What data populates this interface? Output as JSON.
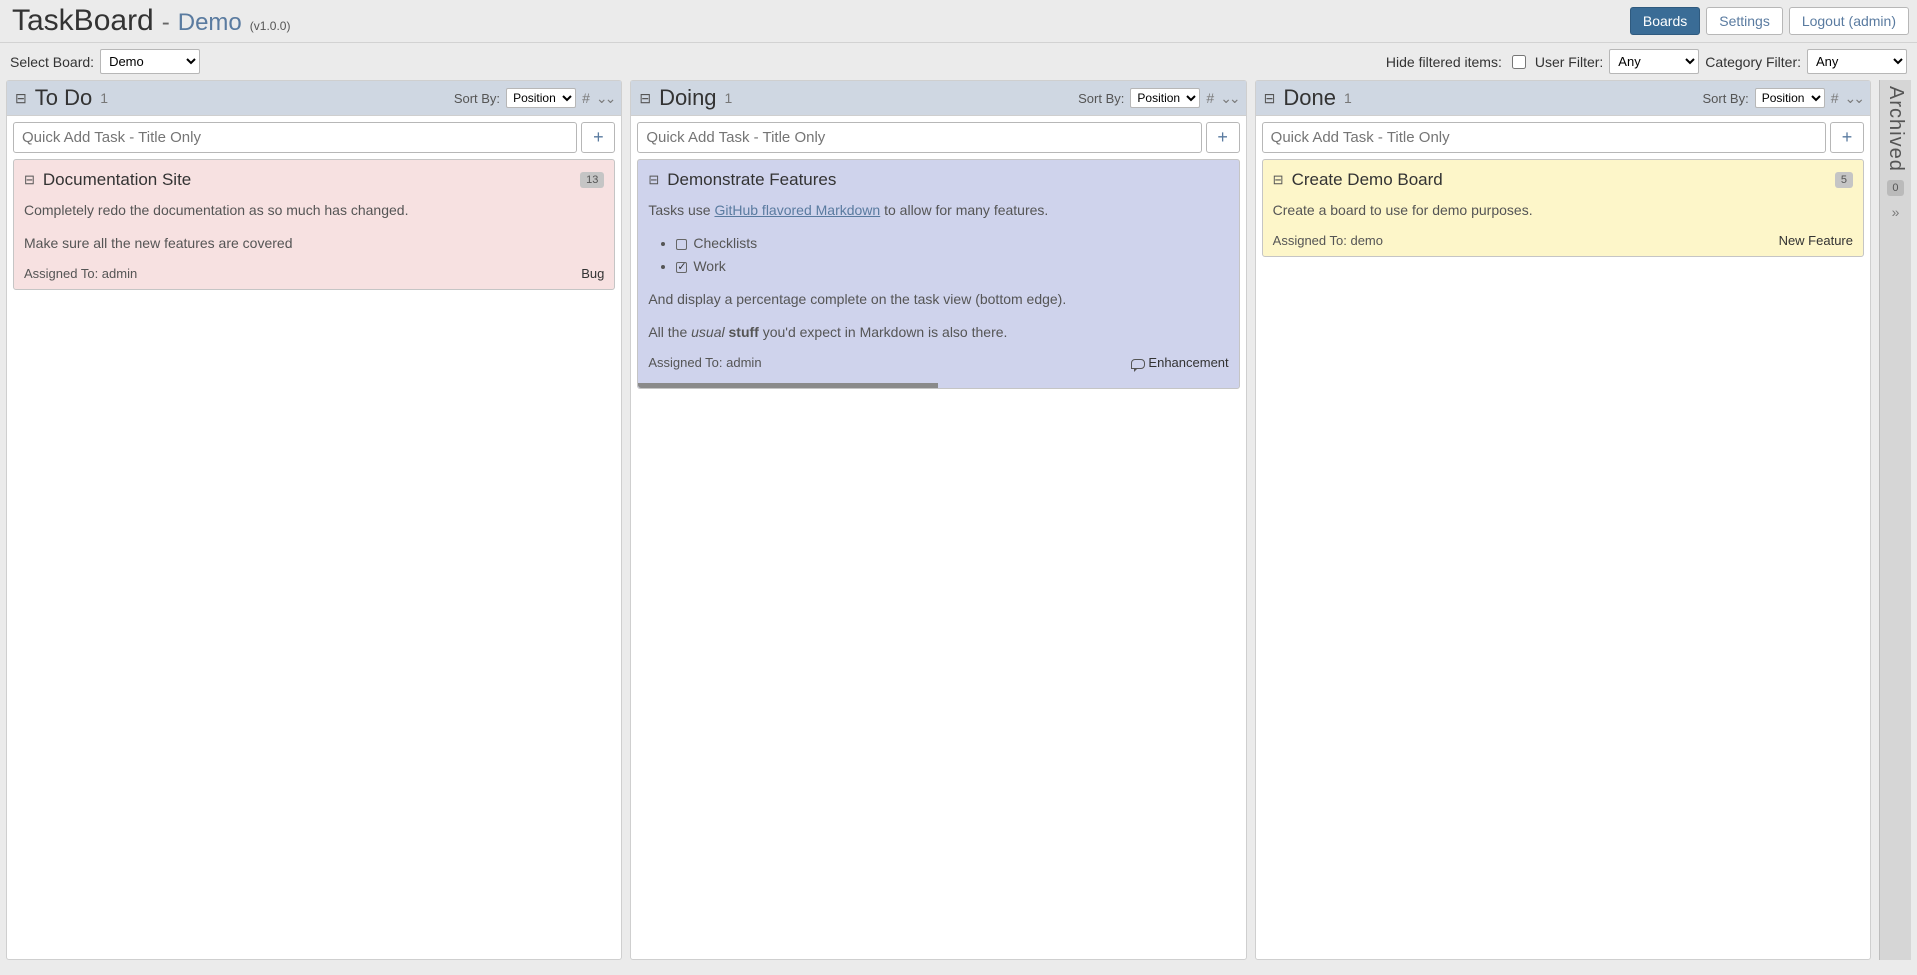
{
  "header": {
    "app_title": "TaskBoard",
    "board_title": "Demo",
    "version": "(v1.0.0)",
    "dash": "-",
    "nav": {
      "boards": "Boards",
      "settings": "Settings",
      "logout": "Logout (admin)"
    }
  },
  "toolbar": {
    "select_board_label": "Select Board:",
    "select_board_value": "Demo",
    "hide_filtered_label": "Hide filtered items:",
    "user_filter_label": "User Filter:",
    "user_filter_value": "Any",
    "category_filter_label": "Category Filter:",
    "category_filter_value": "Any"
  },
  "columns": {
    "sortby_label": "Sort By:",
    "sort_value": "Position",
    "quickadd_placeholder": "Quick Add Task - Title Only"
  },
  "todo": {
    "name": "To Do",
    "count": "1",
    "card": {
      "title": "Documentation Site",
      "badge": "13",
      "p1": "Completely redo the documentation as so much has changed.",
      "p2": "Make sure all the new features are covered",
      "assigned": "Assigned To: admin",
      "tag": "Bug"
    }
  },
  "doing": {
    "name": "Doing",
    "count": "1",
    "card": {
      "title": "Demonstrate Features",
      "intro_pre": "Tasks use ",
      "intro_link": "GitHub flavored Markdown",
      "intro_post": " to allow for many features.",
      "check_item1": "Checklists",
      "check_item2": "Work",
      "p2": "And display a percentage complete on the task view (bottom edge).",
      "p3_pre": "All the ",
      "p3_em": "usual",
      "p3_mid": " ",
      "p3_strong": "stuff",
      "p3_post": " you'd expect in Markdown is also there.",
      "assigned": "Assigned To: admin",
      "tag": "Enhancement"
    }
  },
  "done": {
    "name": "Done",
    "count": "1",
    "card": {
      "title": "Create Demo Board",
      "badge": "5",
      "p1": "Create a board to use for demo purposes.",
      "assigned": "Assigned To: demo",
      "tag": "New Feature"
    }
  },
  "archived": {
    "label": "Archived",
    "count": "0",
    "expand": "»"
  },
  "icons": {
    "collapse": "⊟",
    "hash": "#",
    "dblarrow": "»",
    "plus": "+"
  }
}
